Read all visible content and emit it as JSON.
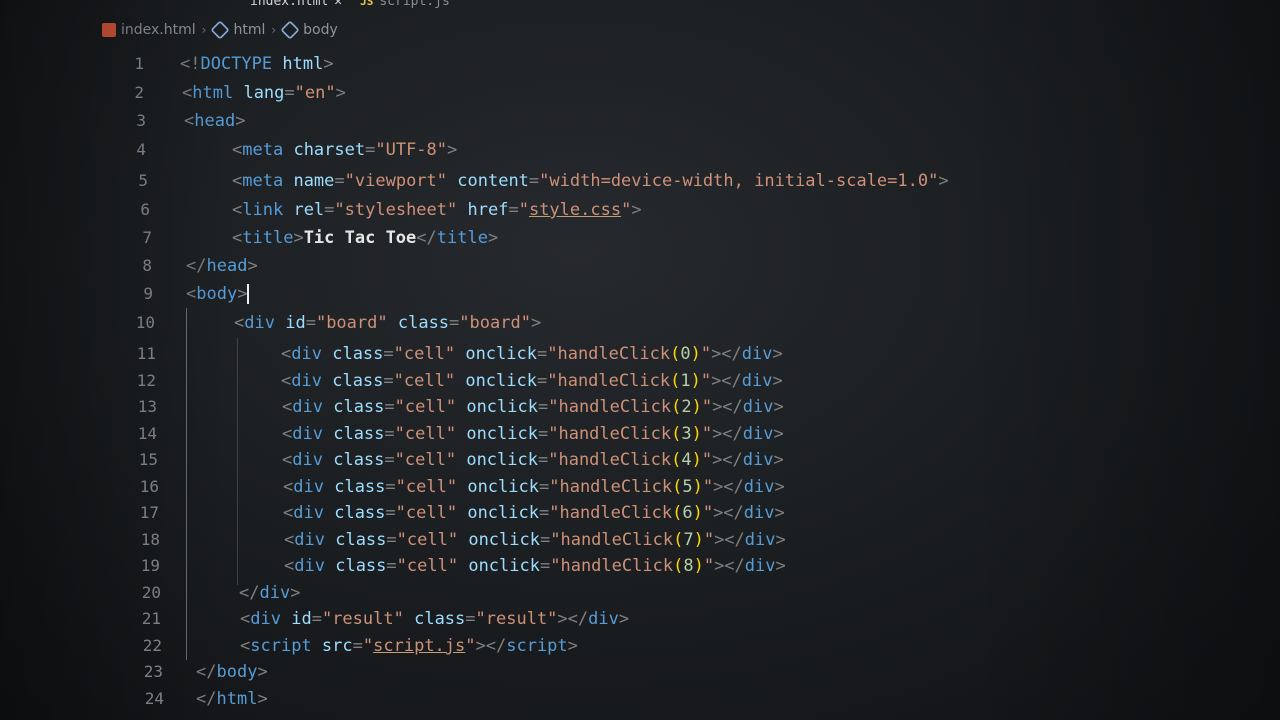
{
  "tabs": [
    {
      "label": "index.html",
      "active": true,
      "close": "✕"
    },
    {
      "label": "script.js",
      "badge": "JS",
      "active": false
    }
  ],
  "breadcrumb": [
    "index.html",
    "html",
    "body"
  ],
  "lines": [
    {
      "n": "1",
      "t": [
        [
          "p",
          "<!"
        ],
        [
          "tg",
          "DOCTYPE"
        ],
        [
          "p",
          " "
        ],
        [
          "at",
          "html"
        ],
        [
          "p",
          ">"
        ]
      ]
    },
    {
      "n": "2",
      "t": [
        [
          "p",
          "<"
        ],
        [
          "tg",
          "html"
        ],
        [
          "p",
          " "
        ],
        [
          "at",
          "lang"
        ],
        [
          "p",
          "="
        ],
        [
          "st",
          "\"en\""
        ],
        [
          "p",
          ">"
        ]
      ]
    },
    {
      "n": "3",
      "t": [
        [
          "p",
          "<"
        ],
        [
          "tg",
          "head"
        ],
        [
          "p",
          ">"
        ]
      ]
    },
    {
      "n": "4",
      "t": [
        [
          "p",
          "<"
        ],
        [
          "tg",
          "meta"
        ],
        [
          "p",
          " "
        ],
        [
          "at",
          "charset"
        ],
        [
          "p",
          "="
        ],
        [
          "st",
          "\"UTF-8\""
        ],
        [
          "p",
          ">"
        ]
      ]
    },
    {
      "n": "5",
      "t": [
        [
          "p",
          "<"
        ],
        [
          "tg",
          "meta"
        ],
        [
          "p",
          " "
        ],
        [
          "at",
          "name"
        ],
        [
          "p",
          "="
        ],
        [
          "st",
          "\"viewport\""
        ],
        [
          "p",
          " "
        ],
        [
          "at",
          "content"
        ],
        [
          "p",
          "="
        ],
        [
          "st",
          "\"width=device-width, initial-scale=1.0\""
        ],
        [
          "p",
          ">"
        ]
      ]
    },
    {
      "n": "6",
      "t": [
        [
          "p",
          "<"
        ],
        [
          "tg",
          "link"
        ],
        [
          "p",
          " "
        ],
        [
          "at",
          "rel"
        ],
        [
          "p",
          "="
        ],
        [
          "st",
          "\"stylesheet\""
        ],
        [
          "p",
          " "
        ],
        [
          "at",
          "href"
        ],
        [
          "p",
          "="
        ],
        [
          "st",
          "\""
        ],
        [
          "st link",
          "style.css"
        ],
        [
          "st",
          "\""
        ],
        [
          "p",
          ">"
        ]
      ]
    },
    {
      "n": "7",
      "t": [
        [
          "p",
          "<"
        ],
        [
          "tg",
          "title"
        ],
        [
          "p",
          ">"
        ],
        [
          "tx",
          "Tic Tac Toe"
        ],
        [
          "p",
          "</"
        ],
        [
          "tg",
          "title"
        ],
        [
          "p",
          ">"
        ]
      ]
    },
    {
      "n": "8",
      "t": [
        [
          "p",
          "</"
        ],
        [
          "tg",
          "head"
        ],
        [
          "p",
          ">"
        ]
      ]
    },
    {
      "n": "9",
      "t": [
        [
          "p",
          "<"
        ],
        [
          "tg",
          "body"
        ],
        [
          "p",
          ">"
        ]
      ],
      "cursor": true
    },
    {
      "n": "10",
      "t": [
        [
          "p",
          "<"
        ],
        [
          "tg",
          "div"
        ],
        [
          "p",
          " "
        ],
        [
          "at",
          "id"
        ],
        [
          "p",
          "="
        ],
        [
          "st",
          "\"board\""
        ],
        [
          "p",
          " "
        ],
        [
          "at",
          "class"
        ],
        [
          "p",
          "="
        ],
        [
          "st",
          "\"board\""
        ],
        [
          "p",
          ">"
        ]
      ]
    },
    {
      "n": "11",
      "t": [
        [
          "p",
          "<"
        ],
        [
          "tg",
          "div"
        ],
        [
          "p",
          " "
        ],
        [
          "at",
          "class"
        ],
        [
          "p",
          "="
        ],
        [
          "st",
          "\"cell\""
        ],
        [
          "p",
          " "
        ],
        [
          "at",
          "onclick"
        ],
        [
          "p",
          "="
        ],
        [
          "st",
          "\"handleClick"
        ],
        [
          "pr",
          "("
        ],
        [
          "nm",
          "0"
        ],
        [
          "pr",
          ")"
        ],
        [
          "st",
          "\""
        ],
        [
          "p",
          "></"
        ],
        [
          "tg",
          "div"
        ],
        [
          "p",
          ">"
        ]
      ]
    },
    {
      "n": "12",
      "t": [
        [
          "p",
          "<"
        ],
        [
          "tg",
          "div"
        ],
        [
          "p",
          " "
        ],
        [
          "at",
          "class"
        ],
        [
          "p",
          "="
        ],
        [
          "st",
          "\"cell\""
        ],
        [
          "p",
          " "
        ],
        [
          "at",
          "onclick"
        ],
        [
          "p",
          "="
        ],
        [
          "st",
          "\"handleClick"
        ],
        [
          "pr",
          "("
        ],
        [
          "nm",
          "1"
        ],
        [
          "pr",
          ")"
        ],
        [
          "st",
          "\""
        ],
        [
          "p",
          "></"
        ],
        [
          "tg",
          "div"
        ],
        [
          "p",
          ">"
        ]
      ]
    },
    {
      "n": "13",
      "t": [
        [
          "p",
          "<"
        ],
        [
          "tg",
          "div"
        ],
        [
          "p",
          " "
        ],
        [
          "at",
          "class"
        ],
        [
          "p",
          "="
        ],
        [
          "st",
          "\"cell\""
        ],
        [
          "p",
          " "
        ],
        [
          "at",
          "onclick"
        ],
        [
          "p",
          "="
        ],
        [
          "st",
          "\"handleClick"
        ],
        [
          "pr",
          "("
        ],
        [
          "nm",
          "2"
        ],
        [
          "pr",
          ")"
        ],
        [
          "st",
          "\""
        ],
        [
          "p",
          "></"
        ],
        [
          "tg",
          "div"
        ],
        [
          "p",
          ">"
        ]
      ]
    },
    {
      "n": "14",
      "t": [
        [
          "p",
          "<"
        ],
        [
          "tg",
          "div"
        ],
        [
          "p",
          " "
        ],
        [
          "at",
          "class"
        ],
        [
          "p",
          "="
        ],
        [
          "st",
          "\"cell\""
        ],
        [
          "p",
          " "
        ],
        [
          "at",
          "onclick"
        ],
        [
          "p",
          "="
        ],
        [
          "st",
          "\"handleClick"
        ],
        [
          "pr",
          "("
        ],
        [
          "nm",
          "3"
        ],
        [
          "pr",
          ")"
        ],
        [
          "st",
          "\""
        ],
        [
          "p",
          "></"
        ],
        [
          "tg",
          "div"
        ],
        [
          "p",
          ">"
        ]
      ]
    },
    {
      "n": "15",
      "t": [
        [
          "p",
          "<"
        ],
        [
          "tg",
          "div"
        ],
        [
          "p",
          " "
        ],
        [
          "at",
          "class"
        ],
        [
          "p",
          "="
        ],
        [
          "st",
          "\"cell\""
        ],
        [
          "p",
          " "
        ],
        [
          "at",
          "onclick"
        ],
        [
          "p",
          "="
        ],
        [
          "st",
          "\"handleClick"
        ],
        [
          "pr",
          "("
        ],
        [
          "nm",
          "4"
        ],
        [
          "pr",
          ")"
        ],
        [
          "st",
          "\""
        ],
        [
          "p",
          "></"
        ],
        [
          "tg",
          "div"
        ],
        [
          "p",
          ">"
        ]
      ]
    },
    {
      "n": "16",
      "t": [
        [
          "p",
          "<"
        ],
        [
          "tg",
          "div"
        ],
        [
          "p",
          " "
        ],
        [
          "at",
          "class"
        ],
        [
          "p",
          "="
        ],
        [
          "st",
          "\"cell\""
        ],
        [
          "p",
          " "
        ],
        [
          "at",
          "onclick"
        ],
        [
          "p",
          "="
        ],
        [
          "st",
          "\"handleClick"
        ],
        [
          "pr",
          "("
        ],
        [
          "nm",
          "5"
        ],
        [
          "pr",
          ")"
        ],
        [
          "st",
          "\""
        ],
        [
          "p",
          "></"
        ],
        [
          "tg",
          "div"
        ],
        [
          "p",
          ">"
        ]
      ]
    },
    {
      "n": "17",
      "t": [
        [
          "p",
          "<"
        ],
        [
          "tg",
          "div"
        ],
        [
          "p",
          " "
        ],
        [
          "at",
          "class"
        ],
        [
          "p",
          "="
        ],
        [
          "st",
          "\"cell\""
        ],
        [
          "p",
          " "
        ],
        [
          "at",
          "onclick"
        ],
        [
          "p",
          "="
        ],
        [
          "st",
          "\"handleClick"
        ],
        [
          "pr",
          "("
        ],
        [
          "nm",
          "6"
        ],
        [
          "pr",
          ")"
        ],
        [
          "st",
          "\""
        ],
        [
          "p",
          "></"
        ],
        [
          "tg",
          "div"
        ],
        [
          "p",
          ">"
        ]
      ]
    },
    {
      "n": "18",
      "t": [
        [
          "p",
          "<"
        ],
        [
          "tg",
          "div"
        ],
        [
          "p",
          " "
        ],
        [
          "at",
          "class"
        ],
        [
          "p",
          "="
        ],
        [
          "st",
          "\"cell\""
        ],
        [
          "p",
          " "
        ],
        [
          "at",
          "onclick"
        ],
        [
          "p",
          "="
        ],
        [
          "st",
          "\"handleClick"
        ],
        [
          "pr",
          "("
        ],
        [
          "nm",
          "7"
        ],
        [
          "pr",
          ")"
        ],
        [
          "st",
          "\""
        ],
        [
          "p",
          "></"
        ],
        [
          "tg",
          "div"
        ],
        [
          "p",
          ">"
        ]
      ]
    },
    {
      "n": "19",
      "t": [
        [
          "p",
          "<"
        ],
        [
          "tg",
          "div"
        ],
        [
          "p",
          " "
        ],
        [
          "at",
          "class"
        ],
        [
          "p",
          "="
        ],
        [
          "st",
          "\"cell\""
        ],
        [
          "p",
          " "
        ],
        [
          "at",
          "onclick"
        ],
        [
          "p",
          "="
        ],
        [
          "st",
          "\"handleClick"
        ],
        [
          "pr",
          "("
        ],
        [
          "nm",
          "8"
        ],
        [
          "pr",
          ")"
        ],
        [
          "st",
          "\""
        ],
        [
          "p",
          "></"
        ],
        [
          "tg",
          "div"
        ],
        [
          "p",
          ">"
        ]
      ]
    },
    {
      "n": "20",
      "t": [
        [
          "p",
          "</"
        ],
        [
          "tg",
          "div"
        ],
        [
          "p",
          ">"
        ]
      ]
    },
    {
      "n": "21",
      "t": [
        [
          "p",
          "<"
        ],
        [
          "tg",
          "div"
        ],
        [
          "p",
          " "
        ],
        [
          "at",
          "id"
        ],
        [
          "p",
          "="
        ],
        [
          "st",
          "\"result\""
        ],
        [
          "p",
          " "
        ],
        [
          "at",
          "class"
        ],
        [
          "p",
          "="
        ],
        [
          "st",
          "\"result\""
        ],
        [
          "p",
          "></"
        ],
        [
          "tg",
          "div"
        ],
        [
          "p",
          ">"
        ]
      ]
    },
    {
      "n": "22",
      "t": [
        [
          "p",
          "<"
        ],
        [
          "tg",
          "script"
        ],
        [
          "p",
          " "
        ],
        [
          "at",
          "src"
        ],
        [
          "p",
          "="
        ],
        [
          "st",
          "\""
        ],
        [
          "st link",
          "script.js"
        ],
        [
          "st",
          "\""
        ],
        [
          "p",
          "></"
        ],
        [
          "tg",
          "script"
        ],
        [
          "p",
          ">"
        ]
      ]
    },
    {
      "n": "23",
      "t": [
        [
          "p",
          "</"
        ],
        [
          "tg",
          "body"
        ],
        [
          "p",
          ">"
        ]
      ]
    },
    {
      "n": "24",
      "t": [
        [
          "p",
          "</"
        ],
        [
          "tg",
          "html"
        ],
        [
          "p",
          ">"
        ]
      ]
    }
  ],
  "colors": {
    "tag": "#569cd6",
    "attribute": "#9cdcfe",
    "string": "#ce9178",
    "punctuation": "#808080",
    "number": "#b5cea8",
    "bracket": "#ffd700"
  }
}
